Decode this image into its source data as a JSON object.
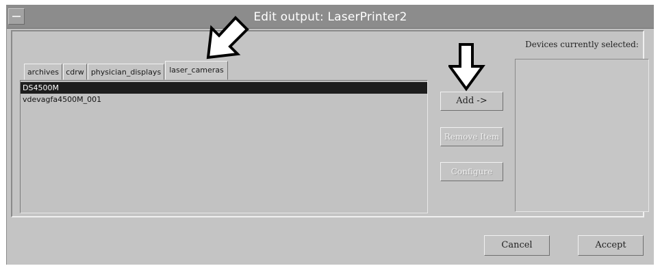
{
  "window": {
    "title": "Edit output: LaserPrinter2"
  },
  "tabs": [
    {
      "label": "archives",
      "active": false
    },
    {
      "label": "cdrw",
      "active": false
    },
    {
      "label": "physician_displays",
      "active": false
    },
    {
      "label": "laser_cameras",
      "active": true
    }
  ],
  "device_list": {
    "items": [
      {
        "label": "DS4500M",
        "selected": true
      },
      {
        "label": "vdevagfa4500M_001",
        "selected": false
      }
    ]
  },
  "actions": {
    "add_label": "Add ->",
    "remove_label": "Remove Item",
    "configure_label": "Configure"
  },
  "selected_panel": {
    "label": "Devices currently selected:",
    "items": []
  },
  "footer": {
    "cancel_label": "Cancel",
    "accept_label": "Accept"
  },
  "icons": {
    "menu": "window-menu-icon",
    "arrow_tab": "annotation-arrow-icon",
    "arrow_add": "annotation-arrow-down-icon"
  }
}
